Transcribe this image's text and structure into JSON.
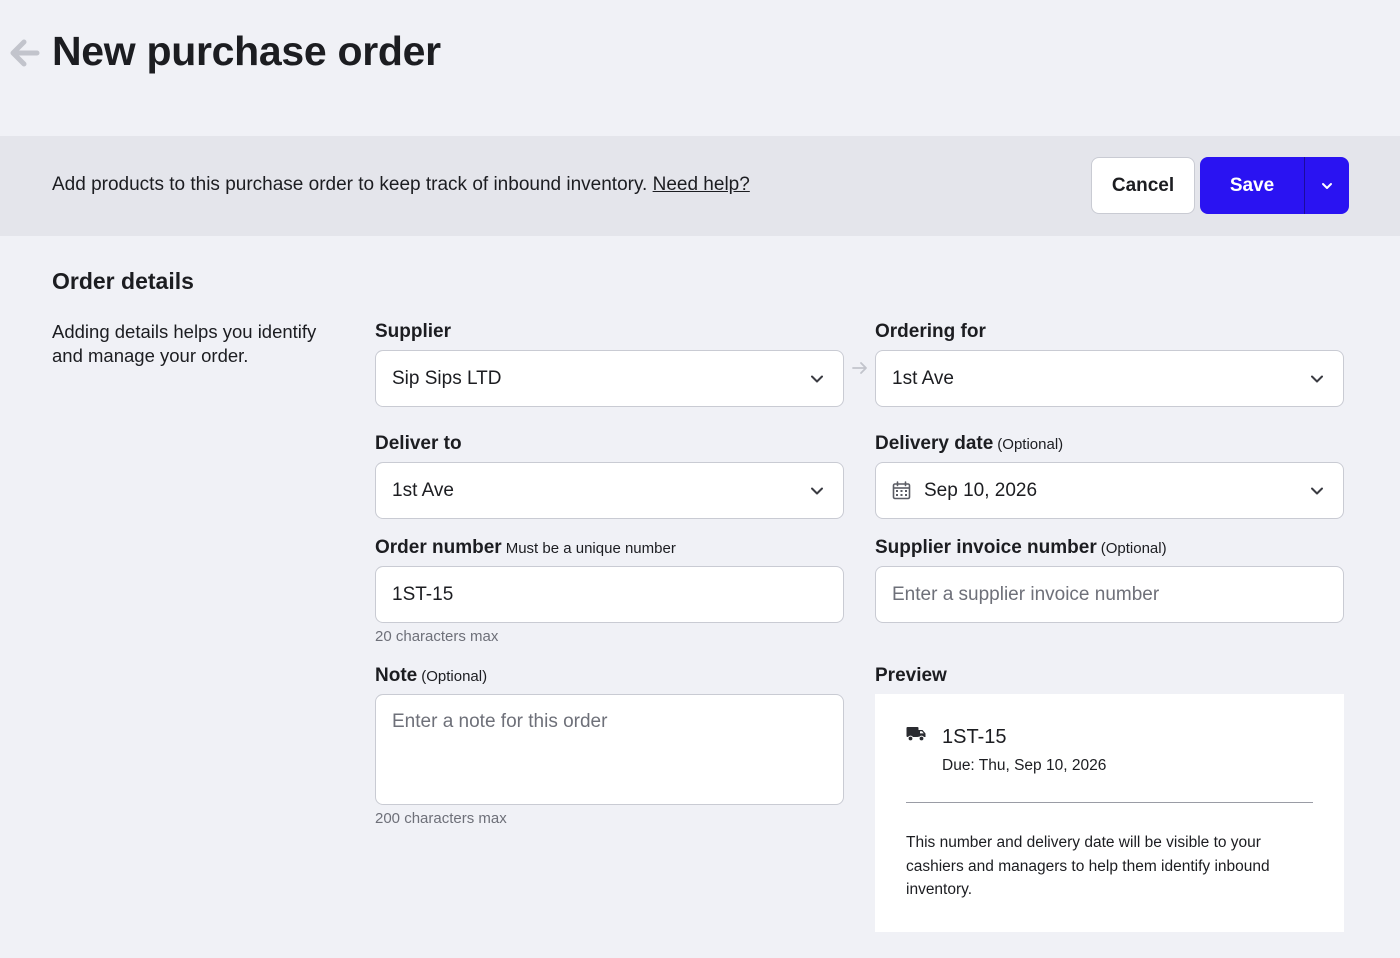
{
  "header": {
    "title": "New purchase order"
  },
  "banner": {
    "text": "Add products to this purchase order to keep track of inbound inventory.",
    "help_link": "Need help?",
    "cancel_label": "Cancel",
    "save_label": "Save"
  },
  "order_details": {
    "title": "Order details",
    "description": "Adding details helps you identify and manage your order."
  },
  "form": {
    "supplier": {
      "label": "Supplier",
      "value": "Sip Sips LTD"
    },
    "ordering_for": {
      "label": "Ordering for",
      "value": "1st Ave"
    },
    "deliver_to": {
      "label": "Deliver to",
      "value": "1st Ave"
    },
    "delivery_date": {
      "label": "Delivery date",
      "sublabel": "(Optional)",
      "value": "Sep 10, 2026"
    },
    "order_number": {
      "label": "Order number",
      "sublabel": "Must be a unique number",
      "value": "1ST-15",
      "hint": "20 characters max"
    },
    "supplier_invoice": {
      "label": "Supplier invoice number",
      "sublabel": "(Optional)",
      "placeholder": "Enter a supplier invoice number",
      "value": ""
    },
    "note": {
      "label": "Note",
      "sublabel": "(Optional)",
      "placeholder": "Enter a note for this order",
      "hint": "200 characters max"
    }
  },
  "preview": {
    "label": "Preview",
    "number": "1ST-15",
    "due": "Due: Thu, Sep 10, 2026",
    "note": "This number and delivery date will be visible to your cashiers and managers to help them identify inbound inventory."
  },
  "colors": {
    "primary": "#2a13f2",
    "background": "#f0f1f6",
    "banner": "#e4e5eb",
    "border": "#c9cbd3",
    "muted_text": "#6e7079"
  },
  "icons": {
    "back": "arrow-left-icon",
    "chevron": "chevron-down-icon",
    "calendar": "calendar-icon",
    "truck": "truck-icon",
    "link": "arrow-right-icon"
  }
}
